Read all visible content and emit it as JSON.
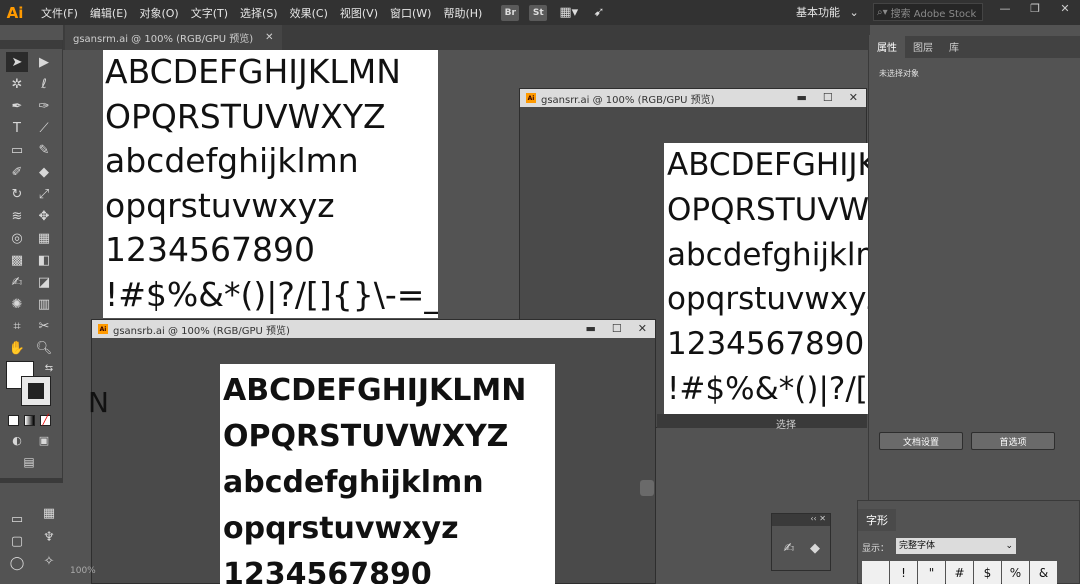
{
  "app": {
    "logo": "Ai"
  },
  "menu": [
    "文件(F)",
    "编辑(E)",
    "对象(O)",
    "文字(T)",
    "选择(S)",
    "效果(C)",
    "视图(V)",
    "窗口(W)",
    "帮助(H)"
  ],
  "toolbar_icons": [
    {
      "label": "Br",
      "icon": "bridge-icon"
    },
    {
      "label": "St",
      "icon": "stock-icon"
    },
    {
      "label": "▦▾",
      "icon": "arrange-documents-icon"
    },
    {
      "label": "➹",
      "icon": "gpu-performance-icon"
    }
  ],
  "workspace": {
    "label": "基本功能",
    "arrow": "⌄"
  },
  "search": {
    "icon": "⌕▾",
    "placeholder": "搜索 Adobe Stock"
  },
  "window_controls": {
    "minimize": "—",
    "restore": "❐",
    "close": "✕"
  },
  "main_tab": {
    "title": "gsansrm.ai @ 100% (RGB/GPU 预览)",
    "close": "✕"
  },
  "doc_right": {
    "title": "gsansrr.ai @ 100% (RGB/GPU 预览)",
    "icon": "Ai",
    "min": "▬",
    "max": "☐",
    "close": "✕"
  },
  "doc_bottom": {
    "title": "gsansrb.ai @ 100% (RGB/GPU 预览)",
    "icon": "Ai",
    "min": "▬",
    "max": "☐",
    "close": "✕"
  },
  "specimen_medium": [
    "ABCDEFGHIJKLMN",
    "OPQRSTUVWXYZ",
    "abcdefghijklmn",
    "opqrstuvwxyz",
    "1234567890",
    "!#$%&*()|?/[]{}\\-=_"
  ],
  "specimen_regular": [
    "ABCDEFGHIJKLMN",
    "OPQRSTUVWXYZ",
    "abcdefghijklmn",
    "opqrstuvwxyz",
    "1234567890",
    "!#$%&*()|?/[]{}\\"
  ],
  "specimen_bold": [
    "ABCDEFGHIJKLMN",
    "OPQRSTUVWXYZ",
    "abcdefghijklmn",
    "opqrstuvwxyz",
    "1234567890"
  ],
  "stray_letter": "N",
  "status": {
    "select_label": "选择",
    "zoom": "100%"
  },
  "right_panel": {
    "tabs": [
      "属性",
      "图层",
      "库"
    ],
    "note": "未选择对象",
    "doc_settings": "文档设置",
    "preferences": "首选项"
  },
  "glyphs_panel": {
    "title": "字形",
    "show_label": "显示：",
    "show_value": "完整字体",
    "cells": [
      "",
      "!",
      "\"",
      "#",
      "$",
      "%",
      "&"
    ]
  },
  "float_panel": {
    "header": "‹‹ ✕"
  },
  "colors": {
    "menubar": "#323232",
    "workspace": "#535353",
    "accent": "#ff9a00"
  }
}
